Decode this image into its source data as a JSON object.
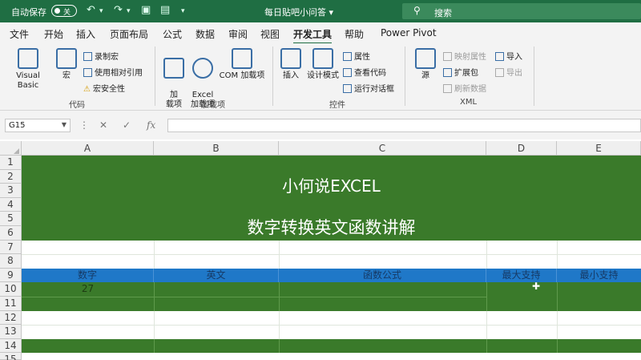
{
  "titlebar": {
    "autosave_label": "自动保存",
    "autosave_state": "关",
    "doc_title": "每日贴吧小问答 ▾",
    "search_placeholder": "搜索",
    "accent": "#1f6e43"
  },
  "tabs": [
    "文件",
    "开始",
    "插入",
    "页面布局",
    "公式",
    "数据",
    "审阅",
    "视图",
    "开发工具",
    "帮助",
    "Power Pivot"
  ],
  "ribbon": {
    "code_group": {
      "label": "代码",
      "visual_basic": "Visual Basic",
      "macros": "宏",
      "record_macro": "录制宏",
      "relative_refs": "使用相对引用",
      "macro_security": "宏安全性"
    },
    "addins_group": {
      "label": "加载项",
      "addins": "加\n载项",
      "excel_addins": "Excel\n加载项",
      "com_addins": "COM 加载项"
    },
    "controls_group": {
      "label": "控件",
      "insert": "插入",
      "design_mode": "设计模式",
      "properties": "属性",
      "view_code": "查看代码",
      "run_dialog": "运行对话框"
    },
    "xml_group": {
      "label": "XML",
      "source": "源",
      "map_properties": "映射属性",
      "expansion_packs": "扩展包",
      "refresh_data": "刷新数据",
      "import": "导入",
      "export": "导出"
    }
  },
  "formula_bar": {
    "name_box": "G15",
    "value": ""
  },
  "sheet": {
    "columns": [
      "A",
      "B",
      "C",
      "D",
      "E"
    ],
    "rows": [
      "1",
      "2",
      "3",
      "4",
      "5",
      "6",
      "7",
      "8",
      "9",
      "10",
      "11",
      "12",
      "13",
      "14",
      "15"
    ],
    "title_line1": "小何说EXCEL",
    "title_line2": "数字转换英文函数讲解",
    "headers": [
      "数字",
      "英文",
      "函数公式",
      "最大支持",
      "最小支持"
    ],
    "a10": "27",
    "title_green": "#3a7a2a",
    "header_blue": "#1f78c8"
  }
}
